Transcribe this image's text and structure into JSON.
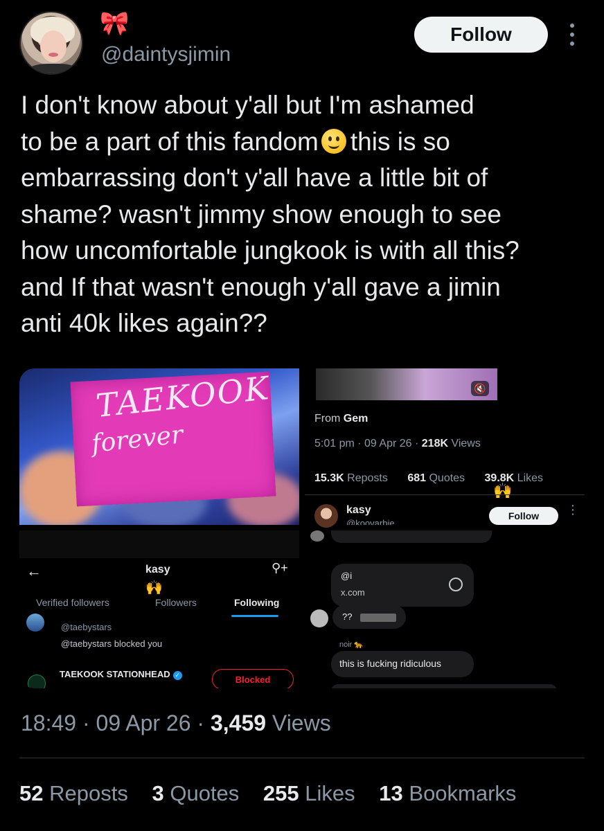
{
  "header": {
    "display_name": "🎀",
    "handle": "@daintysjimin",
    "follow_label": "Follow"
  },
  "tweet": {
    "line1": "I don't know about y'all but I'm ashamed",
    "line2a": "to be a part of this fandom",
    "line2b": "this is so",
    "rest": "embarrassing don't y'all have a little bit of\nshame? wasn't jimmy show enough to see\nhow uncomfortable jungkook is with all this?\nand If that wasn't enough y'all gave a jimin\nanti 40k likes again??"
  },
  "media": {
    "concert": {
      "sign_line1": "TAEKOOK",
      "sign_line2": "forever"
    },
    "quote_stats": {
      "from_label": "From",
      "from_name": "Gem",
      "time": "5:01 pm · 09 Apr 26 ·",
      "views_num": "218K",
      "views_label": "Views",
      "reposts_num": "15.3K",
      "reposts_label": "Reposts",
      "quotes_num": "681",
      "quotes_label": "Quotes",
      "likes_num": "39.8K",
      "likes_label": "Likes",
      "clap": "🙌",
      "profile_name": "kasy",
      "profile_handle": "@koovarbie",
      "follow_label": "Follow",
      "more": "⋮"
    },
    "following_list": {
      "back": "←",
      "title": "kasy",
      "clap": "🙌",
      "add_user": "⚲+",
      "tabs": [
        "Verified followers",
        "Followers",
        "Following"
      ],
      "user1_handle": "@taebystars",
      "user1_status": "@taebystars blocked you",
      "user2_name": "TAEKOOK STATIONHEAD",
      "blocked_label": "Blocked"
    },
    "chat": {
      "link_title": "@i",
      "link_sub": "x.com",
      "qq": "??",
      "noir": "noir 🐆",
      "message": "this is fucking ridiculous"
    }
  },
  "footer": {
    "time": "18:49 · 09 Apr 26 ·",
    "views_num": "3,459",
    "views_label": "Views",
    "stats": [
      {
        "num": "52",
        "label": "Reposts"
      },
      {
        "num": "3",
        "label": "Quotes"
      },
      {
        "num": "255",
        "label": "Likes"
      },
      {
        "num": "13",
        "label": "Bookmarks"
      }
    ]
  },
  "colors": {
    "background": "#000000",
    "accent_blue": "#1d9bf0",
    "blocked_red": "#f4212e",
    "name_pink": "#ff6fa5"
  },
  "icons": [
    "avatar",
    "more-dots-icon",
    "smile-emoji-icon",
    "mute-icon",
    "back-arrow-icon",
    "add-user-icon",
    "verified-badge-icon",
    "link-icon"
  ]
}
